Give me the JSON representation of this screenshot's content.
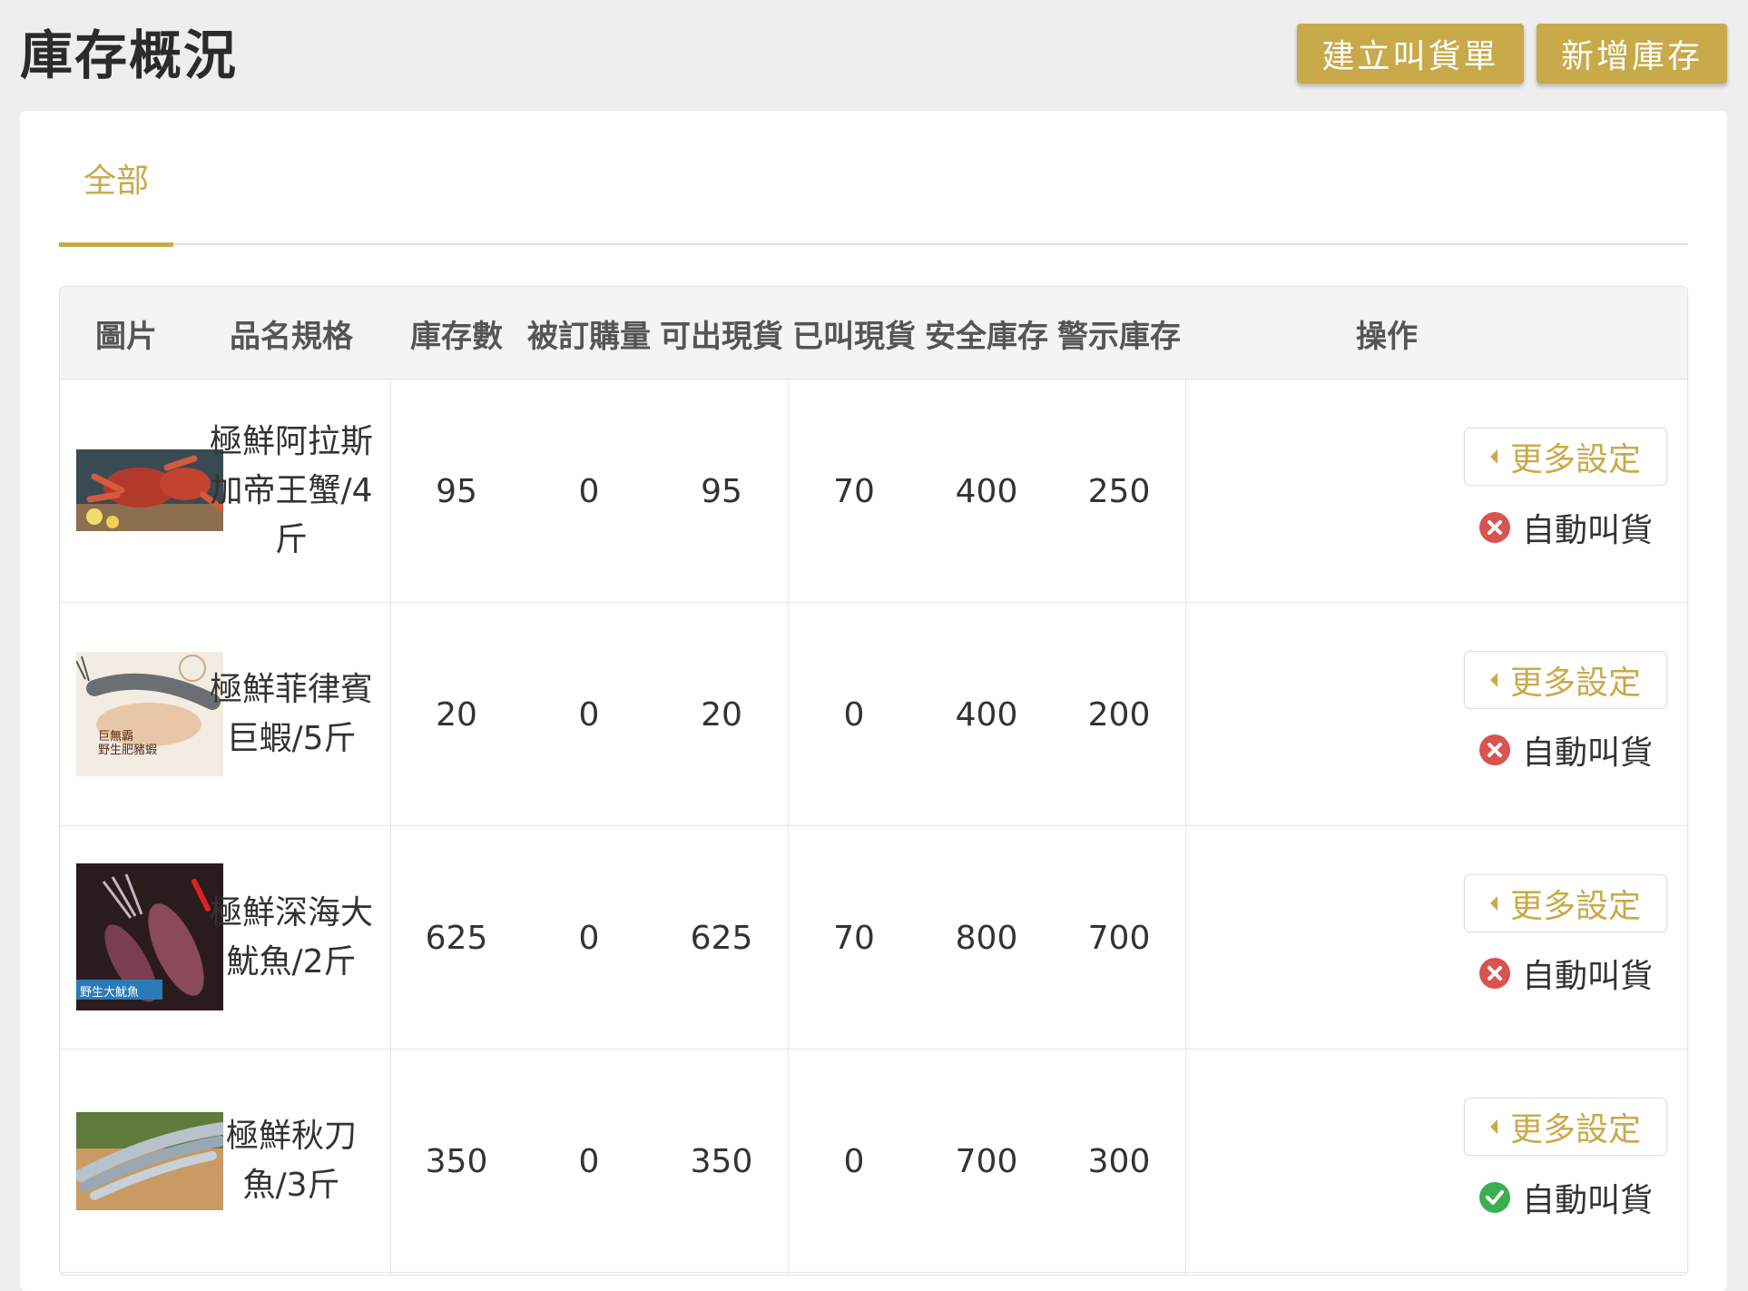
{
  "header": {
    "title": "庫存概況",
    "create_order_label": "建立叫貨單",
    "add_stock_label": "新增庫存"
  },
  "tabs": [
    {
      "label": "全部",
      "active": true
    }
  ],
  "accent_color": "#c9aa4a",
  "table": {
    "columns": [
      "圖片",
      "品名規格",
      "庫存數",
      "被訂購量",
      "可出現貨",
      "已叫現貨",
      "安全庫存",
      "警示庫存",
      "操作"
    ],
    "rows": [
      {
        "name": "極鮮阿拉斯加帝王蟹/4斤",
        "image": "king-crab-photo",
        "stock": "95",
        "ordered": "0",
        "available": "95",
        "called": "70",
        "safety": "400",
        "warning": "250",
        "more_label": "更多設定",
        "auto_label": "自動叫貨",
        "auto_enabled": false
      },
      {
        "name": "極鮮菲律賓巨蝦/5斤",
        "image": "giant-prawn-photo",
        "stock": "20",
        "ordered": "0",
        "available": "20",
        "called": "0",
        "safety": "400",
        "warning": "200",
        "more_label": "更多設定",
        "auto_label": "自動叫貨",
        "auto_enabled": false
      },
      {
        "name": "極鮮深海大魷魚/2斤",
        "image": "squid-photo",
        "stock": "625",
        "ordered": "0",
        "available": "625",
        "called": "70",
        "safety": "800",
        "warning": "700",
        "more_label": "更多設定",
        "auto_label": "自動叫貨",
        "auto_enabled": false
      },
      {
        "name": "極鮮秋刀魚/3斤",
        "image": "saury-photo",
        "stock": "350",
        "ordered": "0",
        "available": "350",
        "called": "0",
        "safety": "700",
        "warning": "300",
        "more_label": "更多設定",
        "auto_label": "自動叫貨",
        "auto_enabled": true
      }
    ]
  },
  "image_labels": {
    "prawn_title": "巨無霸",
    "prawn_sub": "野生肥豬蝦",
    "squid_tag": "野生大魷魚"
  }
}
